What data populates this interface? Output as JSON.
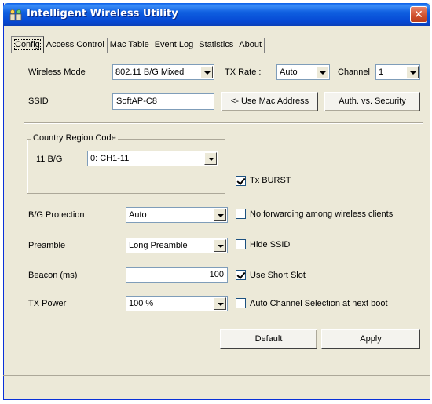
{
  "window": {
    "title": "Intelligent Wireless Utility",
    "close_label": "✕"
  },
  "tabs": [
    {
      "label": "Config",
      "active": true
    },
    {
      "label": "Access Control",
      "active": false
    },
    {
      "label": "Mac Table",
      "active": false
    },
    {
      "label": "Event Log",
      "active": false
    },
    {
      "label": "Statistics",
      "active": false
    },
    {
      "label": "About",
      "active": false
    }
  ],
  "config": {
    "wireless_mode_label": "Wireless Mode",
    "wireless_mode_value": "802.11 B/G Mixed",
    "tx_rate_label": "TX Rate :",
    "tx_rate_value": "Auto",
    "channel_label": "Channel",
    "channel_value": "1",
    "ssid_label": "SSID",
    "ssid_value": "SoftAP-C8",
    "use_mac_button": "<- Use Mac Address",
    "auth_button": "Auth. vs. Security",
    "country_group_title": "Country Region Code",
    "country_band_label": "11 B/G",
    "country_value": "0: CH1-11",
    "tx_burst_label": "Tx BURST",
    "tx_burst_checked": true,
    "bg_protection_label": "B/G Protection",
    "bg_protection_value": "Auto",
    "no_forwarding_label": "No forwarding among wireless clients",
    "no_forwarding_checked": false,
    "preamble_label": "Preamble",
    "preamble_value": "Long Preamble",
    "hide_ssid_label": "Hide SSID",
    "hide_ssid_checked": false,
    "beacon_label": "Beacon (ms)",
    "beacon_value": "100",
    "short_slot_label": "Use Short Slot",
    "short_slot_checked": true,
    "tx_power_label": "TX Power",
    "tx_power_value": "100 %",
    "auto_channel_label": "Auto Channel Selection at next boot",
    "auto_channel_checked": false,
    "default_button": "Default",
    "apply_button": "Apply"
  },
  "colors": {
    "titlebar": "#0a5ee8",
    "window_bg": "#ece9d8",
    "close": "#d0502c"
  }
}
